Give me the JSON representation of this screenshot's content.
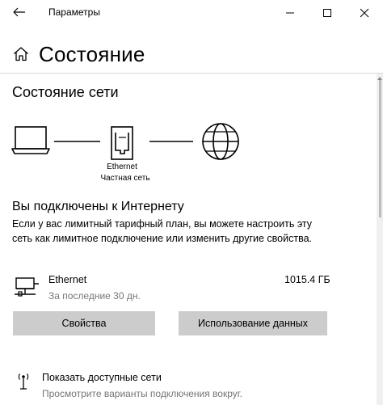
{
  "window": {
    "title": "Параметры"
  },
  "header": {
    "title": "Состояние"
  },
  "network_status": {
    "section_title": "Состояние сети",
    "adapter_label": "Ethernet",
    "network_type": "Частная сеть"
  },
  "connection": {
    "title": "Вы подключены к Интернету",
    "description": "Если у вас лимитный тарифный план, вы можете настроить эту сеть как лимитное подключение или изменить другие свойства."
  },
  "adapter": {
    "name": "Ethernet",
    "period": "За последние 30 дн.",
    "usage": "1015.4 ГБ"
  },
  "buttons": {
    "properties": "Свойства",
    "data_usage": "Использование данных"
  },
  "show_networks": {
    "title": "Показать доступные сети",
    "subtitle": "Просмотрите варианты подключения вокруг."
  },
  "icons": {
    "back": "back-arrow-icon",
    "minimize": "minimize-icon",
    "maximize": "maximize-icon",
    "close": "close-icon",
    "home": "home-icon",
    "laptop": "laptop-icon",
    "ethernet_port": "ethernet-port-icon",
    "globe": "globe-icon",
    "adapter": "ethernet-adapter-icon",
    "available_networks": "antenna-icon"
  },
  "colors": {
    "button_bg": "#cccccc",
    "secondary_text": "#767676",
    "divider": "#d8d8d8"
  }
}
